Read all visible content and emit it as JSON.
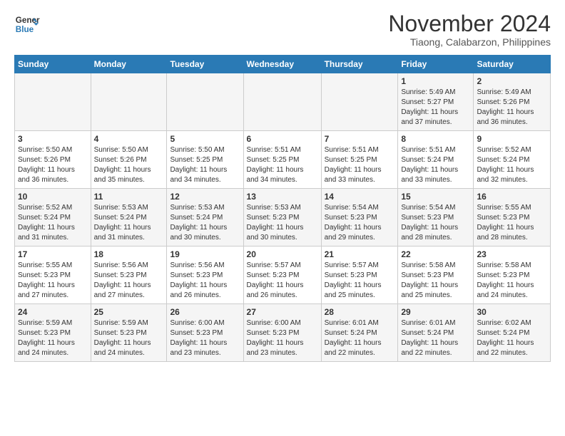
{
  "header": {
    "logo_line1": "General",
    "logo_line2": "Blue",
    "month": "November 2024",
    "location": "Tiaong, Calabarzon, Philippines"
  },
  "weekdays": [
    "Sunday",
    "Monday",
    "Tuesday",
    "Wednesday",
    "Thursday",
    "Friday",
    "Saturday"
  ],
  "weeks": [
    [
      {
        "day": "",
        "info": ""
      },
      {
        "day": "",
        "info": ""
      },
      {
        "day": "",
        "info": ""
      },
      {
        "day": "",
        "info": ""
      },
      {
        "day": "",
        "info": ""
      },
      {
        "day": "1",
        "info": "Sunrise: 5:49 AM\nSunset: 5:27 PM\nDaylight: 11 hours\nand 37 minutes."
      },
      {
        "day": "2",
        "info": "Sunrise: 5:49 AM\nSunset: 5:26 PM\nDaylight: 11 hours\nand 36 minutes."
      }
    ],
    [
      {
        "day": "3",
        "info": "Sunrise: 5:50 AM\nSunset: 5:26 PM\nDaylight: 11 hours\nand 36 minutes."
      },
      {
        "day": "4",
        "info": "Sunrise: 5:50 AM\nSunset: 5:26 PM\nDaylight: 11 hours\nand 35 minutes."
      },
      {
        "day": "5",
        "info": "Sunrise: 5:50 AM\nSunset: 5:25 PM\nDaylight: 11 hours\nand 34 minutes."
      },
      {
        "day": "6",
        "info": "Sunrise: 5:51 AM\nSunset: 5:25 PM\nDaylight: 11 hours\nand 34 minutes."
      },
      {
        "day": "7",
        "info": "Sunrise: 5:51 AM\nSunset: 5:25 PM\nDaylight: 11 hours\nand 33 minutes."
      },
      {
        "day": "8",
        "info": "Sunrise: 5:51 AM\nSunset: 5:24 PM\nDaylight: 11 hours\nand 33 minutes."
      },
      {
        "day": "9",
        "info": "Sunrise: 5:52 AM\nSunset: 5:24 PM\nDaylight: 11 hours\nand 32 minutes."
      }
    ],
    [
      {
        "day": "10",
        "info": "Sunrise: 5:52 AM\nSunset: 5:24 PM\nDaylight: 11 hours\nand 31 minutes."
      },
      {
        "day": "11",
        "info": "Sunrise: 5:53 AM\nSunset: 5:24 PM\nDaylight: 11 hours\nand 31 minutes."
      },
      {
        "day": "12",
        "info": "Sunrise: 5:53 AM\nSunset: 5:24 PM\nDaylight: 11 hours\nand 30 minutes."
      },
      {
        "day": "13",
        "info": "Sunrise: 5:53 AM\nSunset: 5:23 PM\nDaylight: 11 hours\nand 30 minutes."
      },
      {
        "day": "14",
        "info": "Sunrise: 5:54 AM\nSunset: 5:23 PM\nDaylight: 11 hours\nand 29 minutes."
      },
      {
        "day": "15",
        "info": "Sunrise: 5:54 AM\nSunset: 5:23 PM\nDaylight: 11 hours\nand 28 minutes."
      },
      {
        "day": "16",
        "info": "Sunrise: 5:55 AM\nSunset: 5:23 PM\nDaylight: 11 hours\nand 28 minutes."
      }
    ],
    [
      {
        "day": "17",
        "info": "Sunrise: 5:55 AM\nSunset: 5:23 PM\nDaylight: 11 hours\nand 27 minutes."
      },
      {
        "day": "18",
        "info": "Sunrise: 5:56 AM\nSunset: 5:23 PM\nDaylight: 11 hours\nand 27 minutes."
      },
      {
        "day": "19",
        "info": "Sunrise: 5:56 AM\nSunset: 5:23 PM\nDaylight: 11 hours\nand 26 minutes."
      },
      {
        "day": "20",
        "info": "Sunrise: 5:57 AM\nSunset: 5:23 PM\nDaylight: 11 hours\nand 26 minutes."
      },
      {
        "day": "21",
        "info": "Sunrise: 5:57 AM\nSunset: 5:23 PM\nDaylight: 11 hours\nand 25 minutes."
      },
      {
        "day": "22",
        "info": "Sunrise: 5:58 AM\nSunset: 5:23 PM\nDaylight: 11 hours\nand 25 minutes."
      },
      {
        "day": "23",
        "info": "Sunrise: 5:58 AM\nSunset: 5:23 PM\nDaylight: 11 hours\nand 24 minutes."
      }
    ],
    [
      {
        "day": "24",
        "info": "Sunrise: 5:59 AM\nSunset: 5:23 PM\nDaylight: 11 hours\nand 24 minutes."
      },
      {
        "day": "25",
        "info": "Sunrise: 5:59 AM\nSunset: 5:23 PM\nDaylight: 11 hours\nand 24 minutes."
      },
      {
        "day": "26",
        "info": "Sunrise: 6:00 AM\nSunset: 5:23 PM\nDaylight: 11 hours\nand 23 minutes."
      },
      {
        "day": "27",
        "info": "Sunrise: 6:00 AM\nSunset: 5:23 PM\nDaylight: 11 hours\nand 23 minutes."
      },
      {
        "day": "28",
        "info": "Sunrise: 6:01 AM\nSunset: 5:24 PM\nDaylight: 11 hours\nand 22 minutes."
      },
      {
        "day": "29",
        "info": "Sunrise: 6:01 AM\nSunset: 5:24 PM\nDaylight: 11 hours\nand 22 minutes."
      },
      {
        "day": "30",
        "info": "Sunrise: 6:02 AM\nSunset: 5:24 PM\nDaylight: 11 hours\nand 22 minutes."
      }
    ]
  ]
}
